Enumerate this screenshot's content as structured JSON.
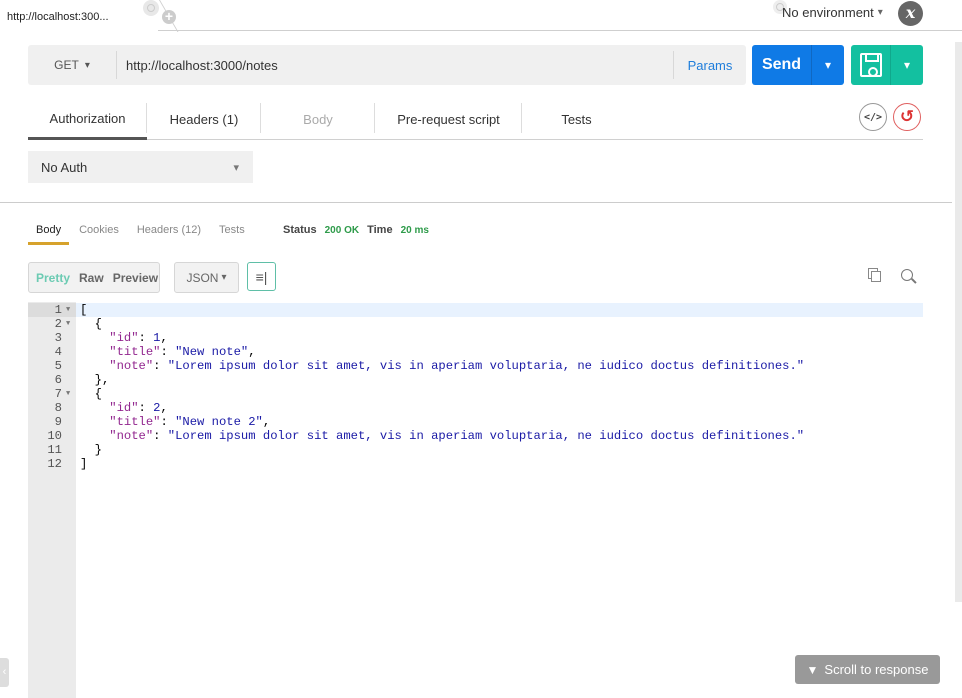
{
  "tabs": {
    "active_tab_label": "http://localhost:300...",
    "add_tab_symbol": "+"
  },
  "environment": {
    "selected": "No environment",
    "chevron": "⌄",
    "settings_glyph": "x"
  },
  "request": {
    "method": "GET",
    "url": "http://localhost:3000/notes",
    "params_label": "Params",
    "send_label": "Send",
    "dropdown_glyph": "⌄"
  },
  "request_tabs": [
    {
      "label": "Authorization",
      "state": "active"
    },
    {
      "label": "Headers (1)",
      "state": "normal"
    },
    {
      "label": "Body",
      "state": "disabled"
    },
    {
      "label": "Pre-request script",
      "state": "normal"
    },
    {
      "label": "Tests",
      "state": "normal"
    }
  ],
  "tools": {
    "code_glyph": "</>",
    "reset_glyph": "↺"
  },
  "auth": {
    "type": "No Auth"
  },
  "response": {
    "tabs": [
      {
        "label": "Body",
        "state": "active"
      },
      {
        "label": "Cookies",
        "state": "normal"
      },
      {
        "label": "Headers (12)",
        "state": "normal"
      },
      {
        "label": "Tests",
        "state": "normal"
      }
    ],
    "status_label": "Status",
    "status_value": "200 OK",
    "time_label": "Time",
    "time_value": "20 ms",
    "view_modes": [
      {
        "label": "Pretty",
        "active": true
      },
      {
        "label": "Raw",
        "active": false
      },
      {
        "label": "Preview",
        "active": false
      }
    ],
    "format": "JSON",
    "wrap_glyph": "≡|",
    "colors": {
      "status_ok": "#2e9b4a",
      "active_tab_underline": "#d6a22c",
      "pretty_active": "#6ccbb3"
    }
  },
  "editor": {
    "lines": [
      {
        "n": "1",
        "fold": true,
        "tokens": [
          {
            "t": "p",
            "v": "["
          }
        ]
      },
      {
        "n": "2",
        "fold": true,
        "tokens": [
          {
            "t": "p",
            "v": "  {"
          }
        ]
      },
      {
        "n": "3",
        "fold": false,
        "tokens": [
          {
            "t": "p",
            "v": "    "
          },
          {
            "t": "key",
            "v": "\"id\""
          },
          {
            "t": "p",
            "v": ": "
          },
          {
            "t": "num",
            "v": "1"
          },
          {
            "t": "p",
            "v": ","
          }
        ]
      },
      {
        "n": "4",
        "fold": false,
        "tokens": [
          {
            "t": "p",
            "v": "    "
          },
          {
            "t": "key",
            "v": "\"title\""
          },
          {
            "t": "p",
            "v": ": "
          },
          {
            "t": "str",
            "v": "\"New note\""
          },
          {
            "t": "p",
            "v": ","
          }
        ]
      },
      {
        "n": "5",
        "fold": false,
        "tokens": [
          {
            "t": "p",
            "v": "    "
          },
          {
            "t": "key",
            "v": "\"note\""
          },
          {
            "t": "p",
            "v": ": "
          },
          {
            "t": "str",
            "v": "\"Lorem ipsum dolor sit amet, vis in aperiam voluptaria, ne iudico doctus definitiones.\""
          }
        ]
      },
      {
        "n": "6",
        "fold": false,
        "tokens": [
          {
            "t": "p",
            "v": "  },"
          }
        ]
      },
      {
        "n": "7",
        "fold": true,
        "tokens": [
          {
            "t": "p",
            "v": "  {"
          }
        ]
      },
      {
        "n": "8",
        "fold": false,
        "tokens": [
          {
            "t": "p",
            "v": "    "
          },
          {
            "t": "key",
            "v": "\"id\""
          },
          {
            "t": "p",
            "v": ": "
          },
          {
            "t": "num",
            "v": "2"
          },
          {
            "t": "p",
            "v": ","
          }
        ]
      },
      {
        "n": "9",
        "fold": false,
        "tokens": [
          {
            "t": "p",
            "v": "    "
          },
          {
            "t": "key",
            "v": "\"title\""
          },
          {
            "t": "p",
            "v": ": "
          },
          {
            "t": "str",
            "v": "\"New note 2\""
          },
          {
            "t": "p",
            "v": ","
          }
        ]
      },
      {
        "n": "10",
        "fold": false,
        "tokens": [
          {
            "t": "p",
            "v": "    "
          },
          {
            "t": "key",
            "v": "\"note\""
          },
          {
            "t": "p",
            "v": ": "
          },
          {
            "t": "str",
            "v": "\"Lorem ipsum dolor sit amet, vis in aperiam voluptaria, ne iudico doctus definitiones.\""
          }
        ]
      },
      {
        "n": "11",
        "fold": false,
        "tokens": [
          {
            "t": "p",
            "v": "  }"
          }
        ]
      },
      {
        "n": "12",
        "fold": false,
        "tokens": [
          {
            "t": "p",
            "v": "]"
          }
        ]
      }
    ]
  },
  "footer": {
    "scroll_to_response": "Scroll to response",
    "collapse_glyph": "‹"
  },
  "colors": {
    "send": "#0f7ae6",
    "save": "#13c0a0",
    "params_link": "#1e7ddb",
    "reset": "#d33333"
  }
}
